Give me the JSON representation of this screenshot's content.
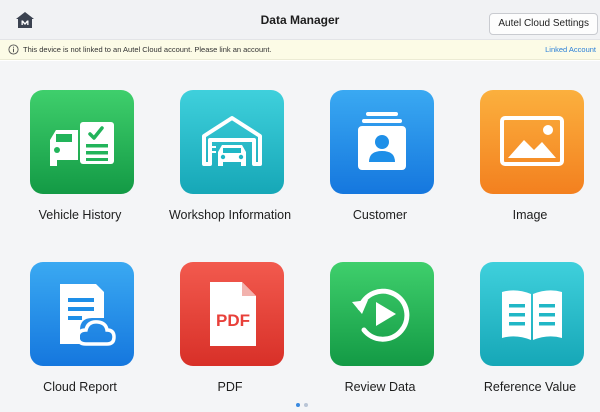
{
  "header": {
    "title": "Data Manager",
    "home_icon": "home-icon",
    "cloud_settings_label": "Autel Cloud Settings"
  },
  "notice": {
    "icon": "info-icon",
    "text": "This device is not linked to an Autel Cloud account. Please link an account.",
    "link_label": "Linked Account"
  },
  "tiles": [
    {
      "label": "Vehicle History",
      "icon": "vehicle-history-icon",
      "color": "#22b45a"
    },
    {
      "label": "Workshop Information",
      "icon": "workshop-icon",
      "color": "#20b7c6"
    },
    {
      "label": "Customer",
      "icon": "customer-icon",
      "color": "#1e8fe8"
    },
    {
      "label": "Image",
      "icon": "image-icon",
      "color": "#f89a2a"
    },
    {
      "label": "Cloud Report",
      "icon": "cloud-report-icon",
      "color": "#1e8fe8"
    },
    {
      "label": "PDF",
      "icon": "pdf-icon",
      "color": "#e8403a"
    },
    {
      "label": "Review Data",
      "icon": "review-data-icon",
      "color": "#22b45a"
    },
    {
      "label": "Reference Value",
      "icon": "reference-value-icon",
      "color": "#20b7c6"
    }
  ],
  "pagination": {
    "pages": 2,
    "current": 1
  }
}
